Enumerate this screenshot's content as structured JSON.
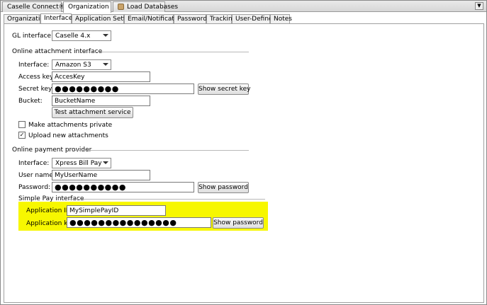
{
  "doc_tabs": [
    {
      "label": "Caselle Connect®"
    },
    {
      "label": "Organization"
    },
    {
      "label": "Load Databases"
    }
  ],
  "sub_tabs": [
    "Organization",
    "Interfaces",
    "Application Settings",
    "Email/Notifications",
    "Passwords",
    "Tracking",
    "User-Defined",
    "Notes"
  ],
  "gl": {
    "label": "GL interface:",
    "value": "Caselle 4.x"
  },
  "attachment": {
    "group_label": "Online attachment interface",
    "interface_label": "Interface:",
    "interface_value": "Amazon S3",
    "access_key_label": "Access key:",
    "access_key_value": "AccesKey",
    "secret_key_label": "Secret key:",
    "secret_key_value": "●●●●●●●●●",
    "show_secret_label": "Show secret key",
    "bucket_label": "Bucket:",
    "bucket_value": "BucketName",
    "test_label": "Test attachment service",
    "private_label": "Make attachments private",
    "private_checked": false,
    "upload_label": "Upload new attachments",
    "upload_checked": true
  },
  "payment": {
    "group_label": "Online payment provider",
    "interface_label": "Interface:",
    "interface_value": "Xpress Bill Pay",
    "username_label": "User name:",
    "username_value": "MyUserName",
    "password_label": "Password:",
    "password_value": "●●●●●●●●●●",
    "show_password_label": "Show password"
  },
  "simple_pay": {
    "group_label": "Simple Pay interface",
    "app_id_label": "Application ID:",
    "app_id_value": "MySimplePayID",
    "app_key_label": "Application key:",
    "app_key_value": "●●●●●●●●●●●●●●●",
    "show_password_label": "Show password",
    "highlight_color": "#f7f700"
  }
}
